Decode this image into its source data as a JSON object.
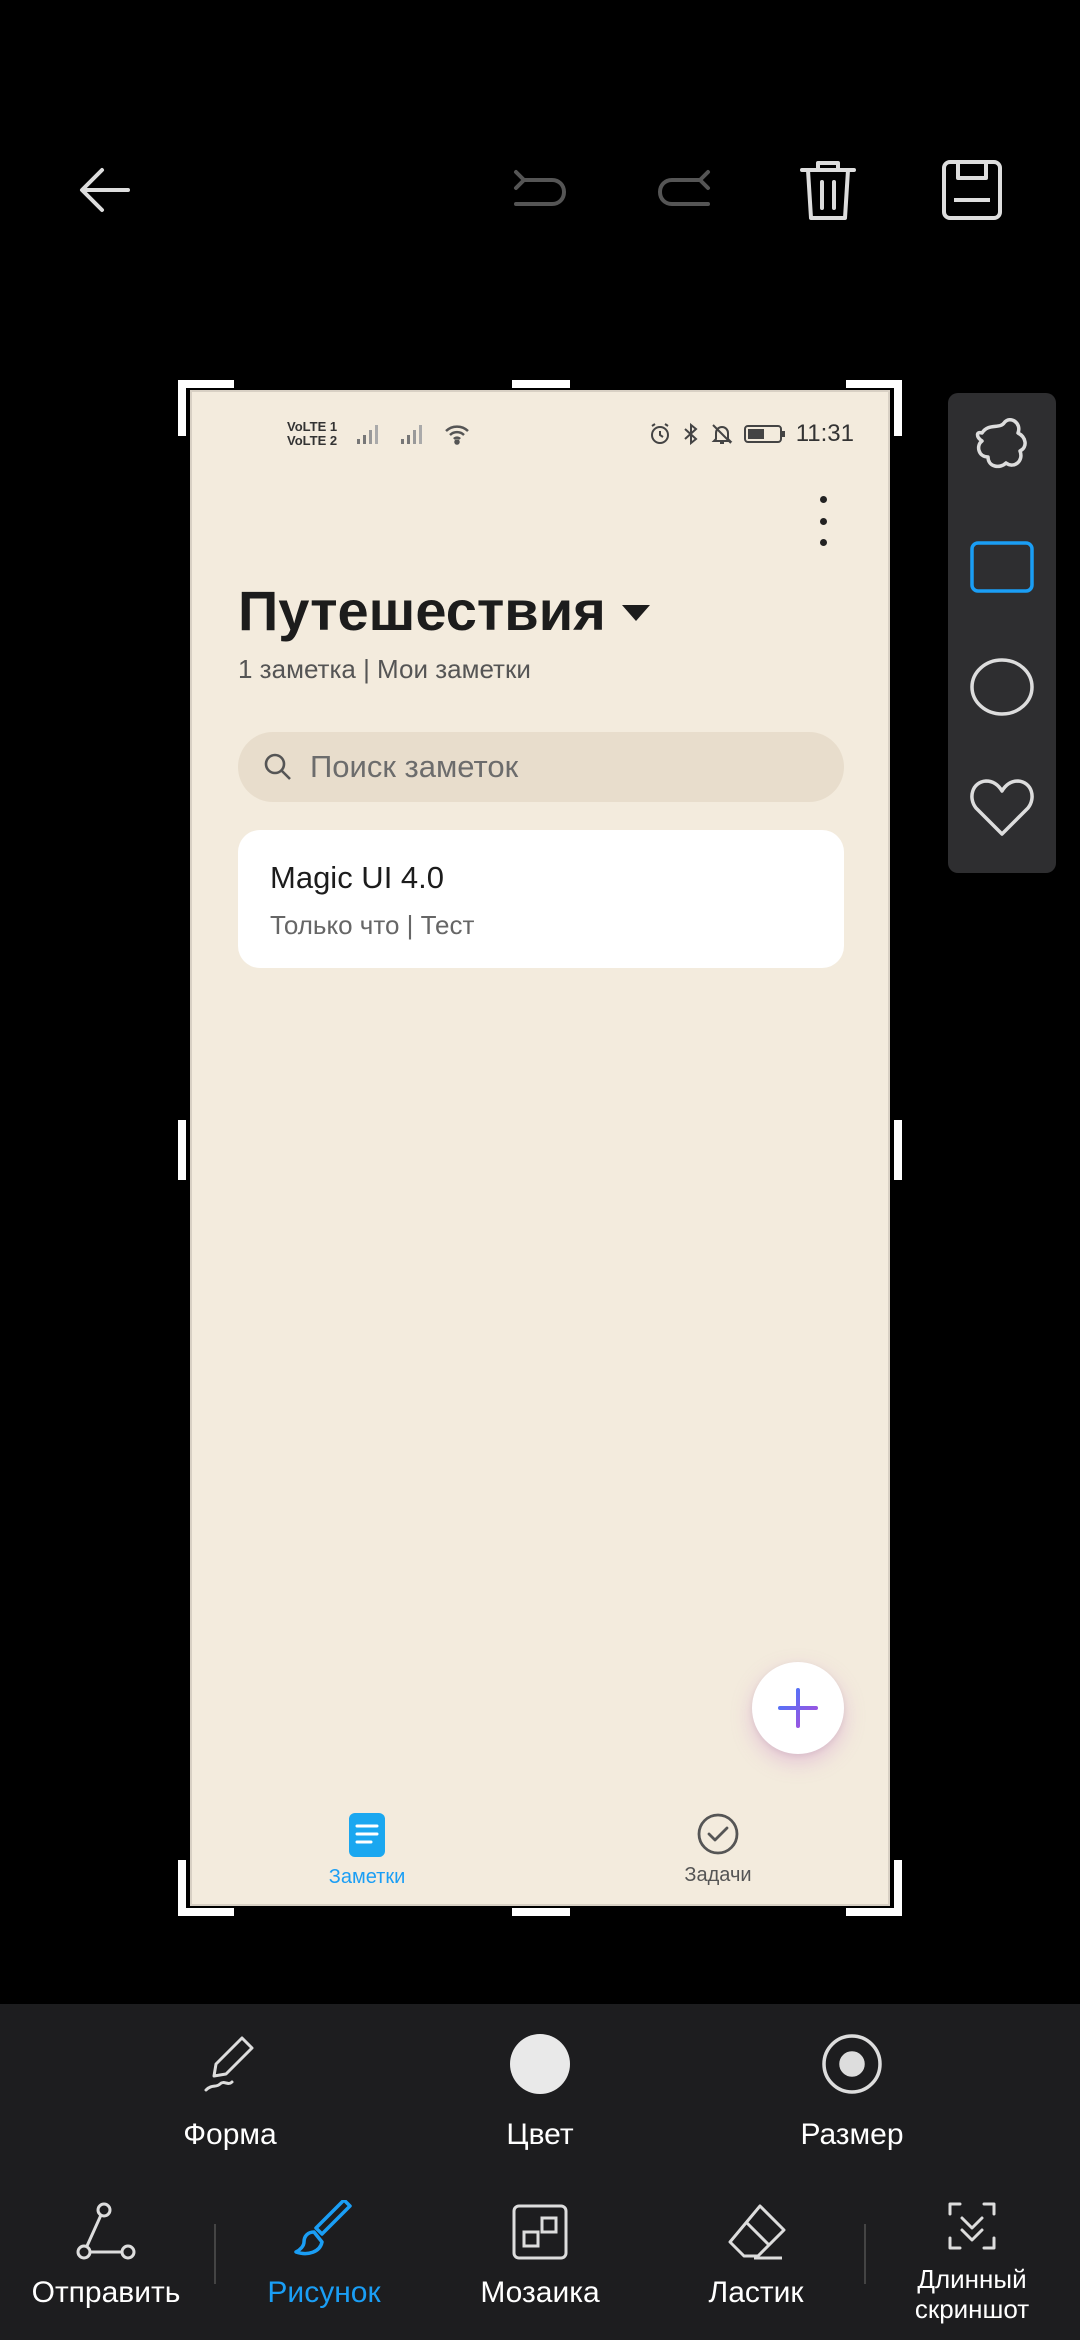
{
  "top_bar": {
    "icons": [
      "back-arrow-icon",
      "undo-icon",
      "redo-icon",
      "trash-icon",
      "save-icon"
    ]
  },
  "screenshot": {
    "status": {
      "volte1": "VoLTE 1",
      "volte2": "VoLTE 2",
      "time": "11:31"
    },
    "title": "Путешествия",
    "subtitle": "1 заметка | Мои заметки",
    "search_placeholder": "Поиск заметок",
    "note": {
      "title": "Magic UI 4.0",
      "meta": "Только что | Тест"
    },
    "nav": {
      "notes_label": "Заметки",
      "tasks_label": "Задачи"
    }
  },
  "palette": {
    "shapes": [
      "freeform-shape-icon",
      "rectangle-icon",
      "circle-icon",
      "heart-icon"
    ],
    "accent": "#1a9ef5"
  },
  "options": {
    "shape_label": "Форма",
    "color_label": "Цвет",
    "size_label": "Размер"
  },
  "tools": {
    "send_label": "Отправить",
    "draw_label": "Рисунок",
    "mosaic_label": "Мозаика",
    "eraser_label": "Ластик",
    "long_screenshot_label_1": "Длинный",
    "long_screenshot_label_2": "скриншот"
  }
}
